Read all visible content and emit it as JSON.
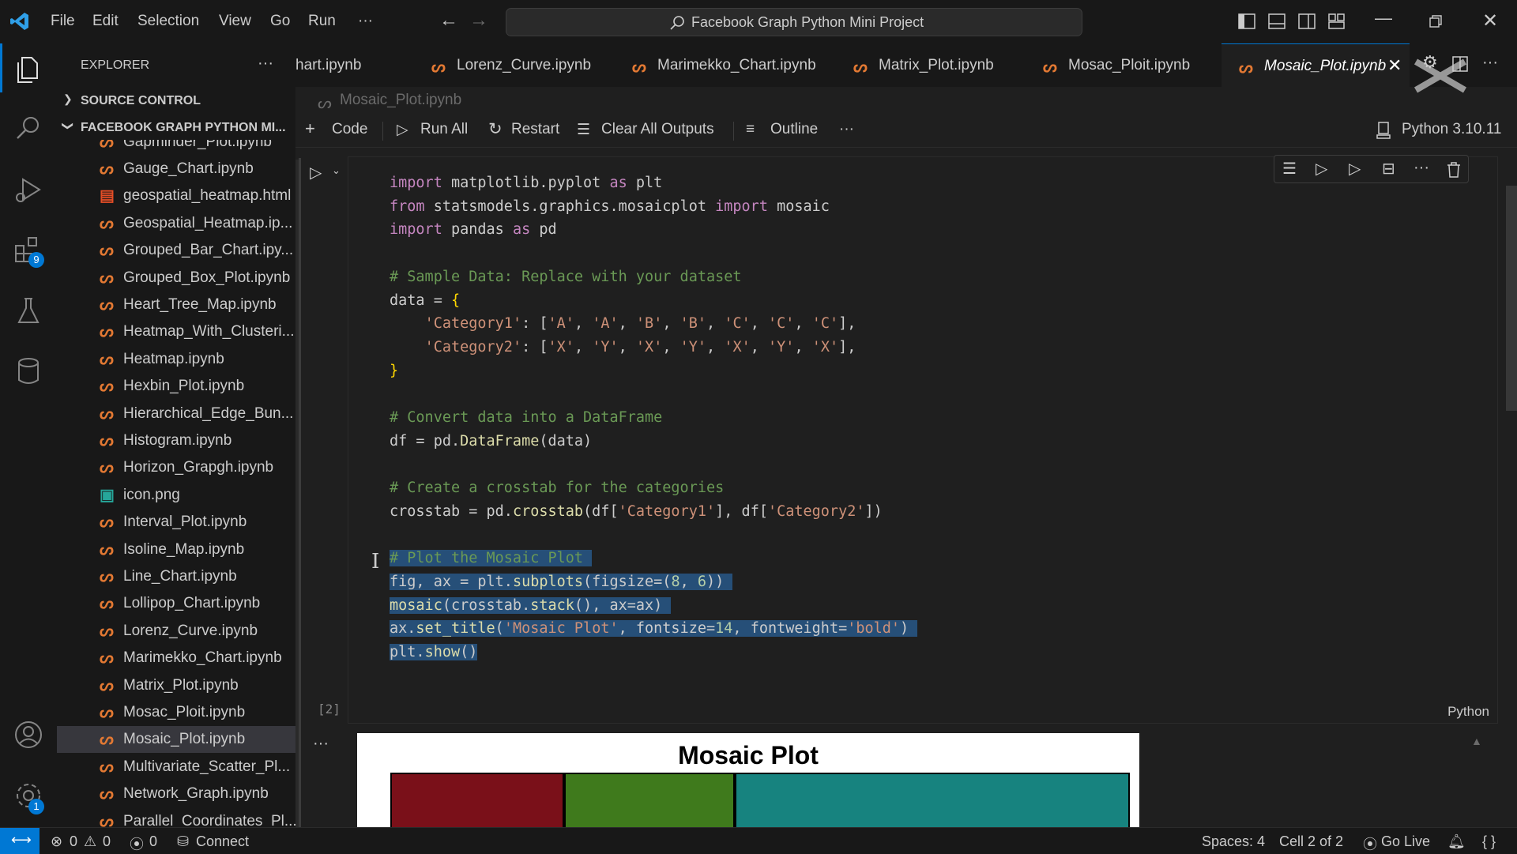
{
  "titlebar": {
    "menu": [
      "File",
      "Edit",
      "Selection",
      "View",
      "Go",
      "Run",
      "···"
    ],
    "search": "Facebook Graph Python Mini Project"
  },
  "activity": {
    "extensions_badge": "9",
    "settings_badge": "1"
  },
  "sidebar": {
    "header": "EXPLORER",
    "more": "···",
    "source_control": "SOURCE CONTROL",
    "project": "FACEBOOK GRAPH PYTHON MI...",
    "partial_top": "Gapminder_Plot.ipynb",
    "files": [
      {
        "name": "Gauge_Chart.ipynb",
        "icon": "notebook-icon"
      },
      {
        "name": "geospatial_heatmap.html",
        "icon": "html-icon"
      },
      {
        "name": "Geospatial_Heatmap.ip...",
        "icon": "notebook-icon"
      },
      {
        "name": "Grouped_Bar_Chart.ipy...",
        "icon": "notebook-icon"
      },
      {
        "name": "Grouped_Box_Plot.ipynb",
        "icon": "notebook-icon"
      },
      {
        "name": "Heart_Tree_Map.ipynb",
        "icon": "notebook-icon"
      },
      {
        "name": "Heatmap_With_Clusteri...",
        "icon": "notebook-icon"
      },
      {
        "name": "Heatmap.ipynb",
        "icon": "notebook-icon"
      },
      {
        "name": "Hexbin_Plot.ipynb",
        "icon": "notebook-icon"
      },
      {
        "name": "Hierarchical_Edge_Bun...",
        "icon": "notebook-icon"
      },
      {
        "name": "Histogram.ipynb",
        "icon": "notebook-icon"
      },
      {
        "name": "Horizon_Grapgh.ipynb",
        "icon": "notebook-icon"
      },
      {
        "name": "icon.png",
        "icon": "image-icon"
      },
      {
        "name": "Interval_Plot.ipynb",
        "icon": "notebook-icon"
      },
      {
        "name": "Isoline_Map.ipynb",
        "icon": "notebook-icon"
      },
      {
        "name": "Line_Chart.ipynb",
        "icon": "notebook-icon"
      },
      {
        "name": "Lollipop_Chart.ipynb",
        "icon": "notebook-icon"
      },
      {
        "name": "Lorenz_Curve.ipynb",
        "icon": "notebook-icon"
      },
      {
        "name": "Marimekko_Chart.ipynb",
        "icon": "notebook-icon"
      },
      {
        "name": "Matrix_Plot.ipynb",
        "icon": "notebook-icon"
      },
      {
        "name": "Mosac_Ploit.ipynb",
        "icon": "notebook-icon"
      },
      {
        "name": "Mosaic_Plot.ipynb",
        "icon": "notebook-icon",
        "active": true
      },
      {
        "name": "Multivariate_Scatter_Pl...",
        "icon": "notebook-icon"
      },
      {
        "name": "Network_Graph.ipynb",
        "icon": "notebook-icon"
      },
      {
        "name": "Parallel_Coordinates_Pl...",
        "icon": "notebook-icon"
      }
    ]
  },
  "tabs": [
    {
      "label": "hart.ipynb"
    },
    {
      "label": "Lorenz_Curve.ipynb"
    },
    {
      "label": "Marimekko_Chart.ipynb"
    },
    {
      "label": "Matrix_Plot.ipynb"
    },
    {
      "label": "Mosac_Ploit.ipynb"
    },
    {
      "label": "Mosaic_Plot.ipynb",
      "active": true
    }
  ],
  "breadcrumb": "Mosaic_Plot.ipynb",
  "toolbar": {
    "code": "Code",
    "run_all": "Run All",
    "restart": "Restart",
    "clear": "Clear All Outputs",
    "outline": "Outline",
    "more": "···",
    "kernel": "Python 3.10.11"
  },
  "cell": {
    "exec_count": "[2]",
    "language": "Python",
    "output_more": "···"
  },
  "output": {
    "title": "Mosaic Plot",
    "colors": [
      "#7a1019",
      "#3f7a1c",
      "#17837f"
    ]
  },
  "status": {
    "errors": "0",
    "warnings": "0",
    "ports": "0",
    "connect": "Connect",
    "spaces": "Spaces: 4",
    "cell": "Cell 2 of 2",
    "golive": "Go Live"
  }
}
